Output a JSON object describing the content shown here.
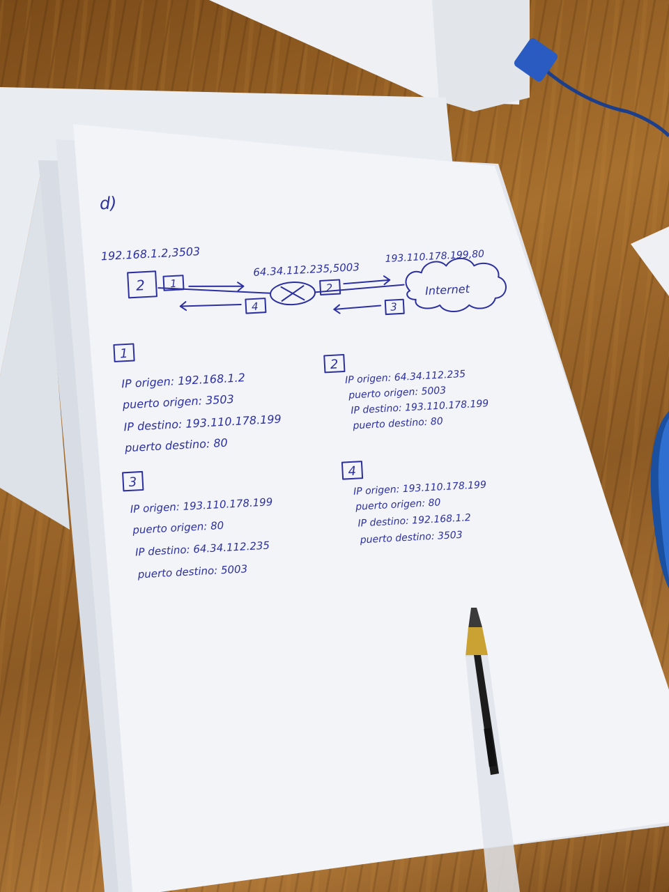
{
  "exercise": {
    "label": "d)"
  },
  "diagram": {
    "client_addr": "192.168.1.2,3503",
    "router_addr": "64.34.112.235,5003",
    "server_addr": "193.110.178.199,80",
    "client_box": "2",
    "cloud_label": "Internet",
    "tags": {
      "t1": "1",
      "t2": "2",
      "t3": "3",
      "t4": "4"
    }
  },
  "packets": [
    {
      "number": "1",
      "lines": [
        "IP origen: 192.168.1.2",
        "puerto origen: 3503",
        "IP destino: 193.110.178.199",
        "puerto destino: 80"
      ]
    },
    {
      "number": "2",
      "lines": [
        "IP origen: 64.34.112.235",
        "puerto origen: 5003",
        "IP destino: 193.110.178.199",
        "puerto destino: 80"
      ]
    },
    {
      "number": "3",
      "lines": [
        "IP origen: 193.110.178.199",
        "puerto origen: 80",
        "IP destino: 64.34.112.235",
        "puerto destino: 5003"
      ]
    },
    {
      "number": "4",
      "lines": [
        "IP origen: 193.110.178.199",
        "puerto origen: 80",
        "IP destino: 192.168.1.2",
        "puerto destino: 3503"
      ]
    }
  ],
  "colors": {
    "ink": "#2b2fa0",
    "paper": "#f4f5f8",
    "wood": "#8a5a22"
  }
}
